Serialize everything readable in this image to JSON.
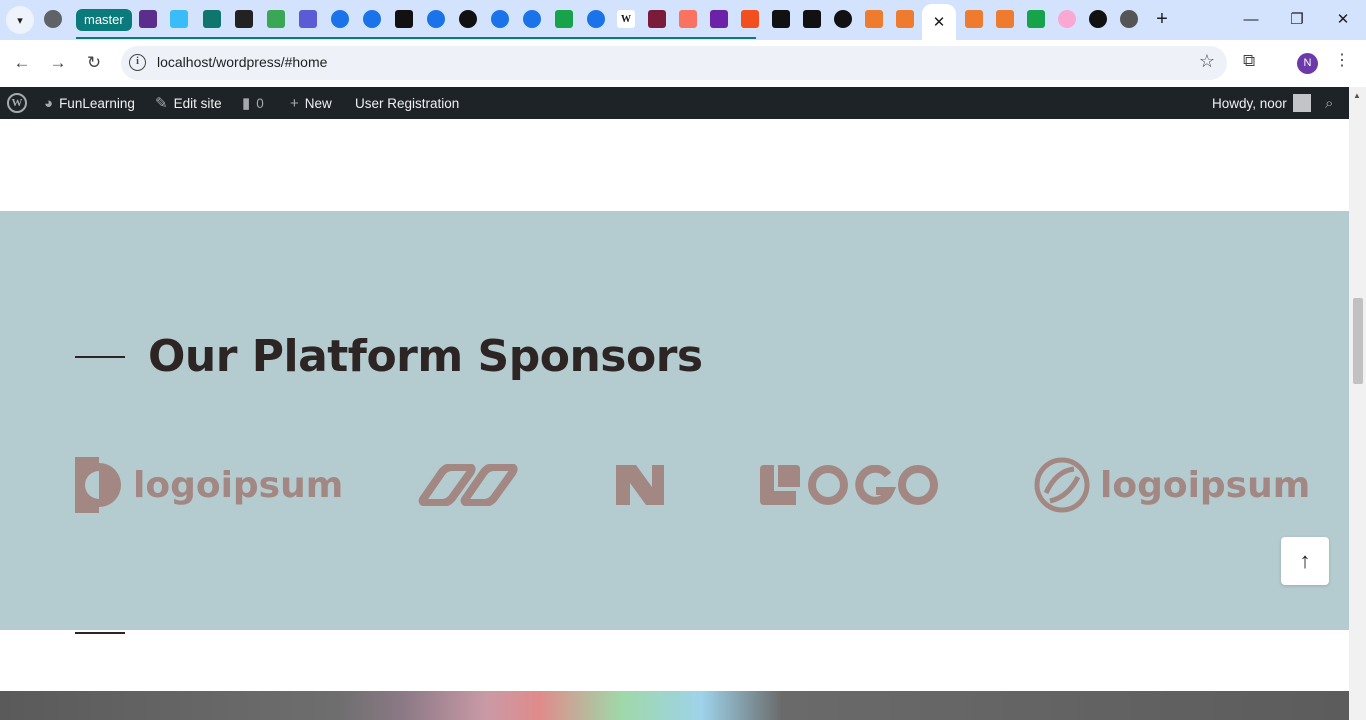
{
  "browser": {
    "tab_group_label": "master",
    "active_tab_close": "✕",
    "new_tab": "+",
    "url": "localhost/wordpress/#home",
    "profile_initial": "N",
    "window_controls": {
      "minimize": "—",
      "restore": "❐",
      "close": "✕"
    },
    "colors": {
      "tab_group": "#0a7a7a",
      "tab_strip": "#d3e3fd",
      "profile": "#6c3aa8"
    }
  },
  "adminbar": {
    "site_name": "FunLearning",
    "edit_site": "Edit site",
    "comments_count": "0",
    "new_label": "New",
    "user_registration": "User Registration",
    "howdy": "Howdy, noor"
  },
  "sponsors": {
    "heading": "Our Platform Sponsors",
    "logos": [
      {
        "name": "logoipsum-mark",
        "text": "logoipsum"
      },
      {
        "name": "infinity-links-mark",
        "text": ""
      },
      {
        "name": "n-mark",
        "text": ""
      },
      {
        "name": "logo-wordmark",
        "text": "LOGO"
      },
      {
        "name": "logoipsum-circle",
        "text": "logoipsum"
      }
    ],
    "colors": {
      "background": "#b4cbcf",
      "logo": "#a38783",
      "heading": "#2c2523"
    }
  },
  "scroll_to_top": "↑"
}
